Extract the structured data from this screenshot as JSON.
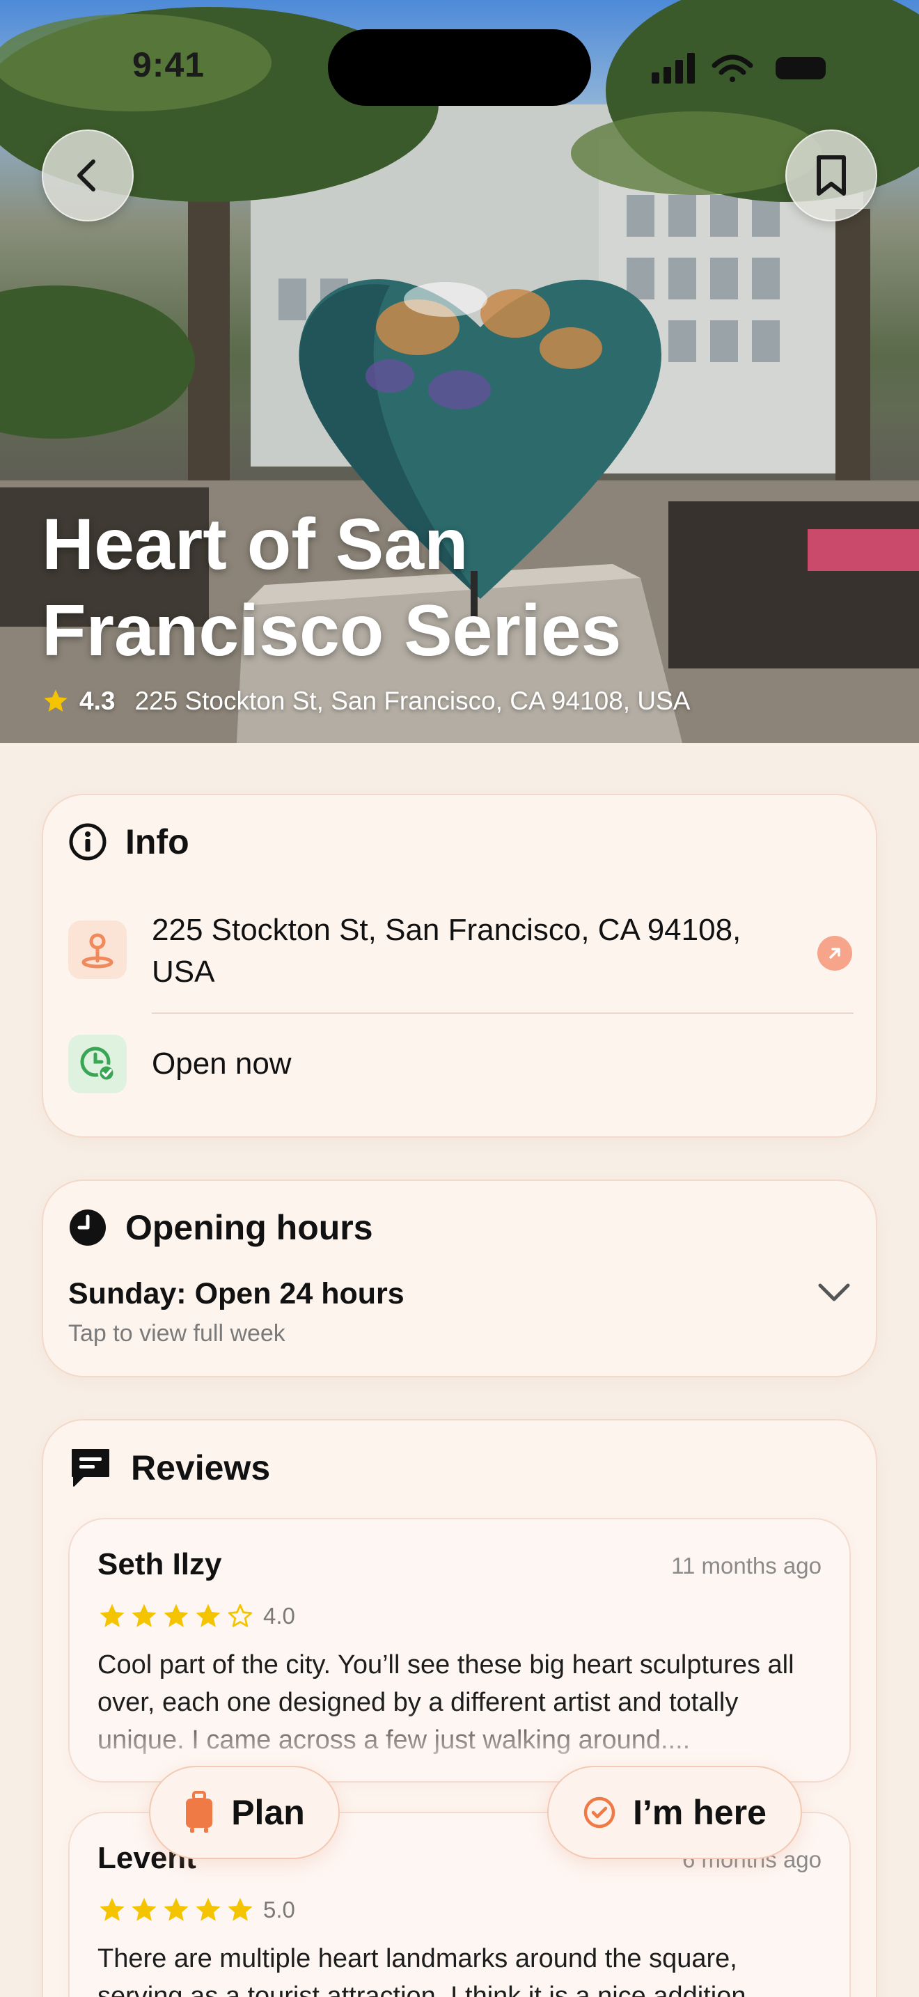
{
  "status_bar": {
    "time": "9:41"
  },
  "hero": {
    "title": "Heart of San Francisco Series",
    "rating": "4.3",
    "address": "225 Stockton St, San Francisco, CA 94108, USA"
  },
  "info": {
    "title": "Info",
    "address": "225 Stockton St, San Francisco, CA 94108, USA",
    "open_status": "Open now"
  },
  "opening_hours": {
    "title": "Opening hours",
    "today": "Sunday: Open 24 hours",
    "hint": "Tap to view full week"
  },
  "reviews": {
    "title": "Reviews",
    "items": [
      {
        "author": "Seth Ilzy",
        "when": "11 months ago",
        "stars": 4,
        "score": "4.0",
        "text": "Cool part of the city. You’ll see these big heart sculptures all over, each one designed by a different artist and totally unique. I came across a few just walking around...."
      },
      {
        "author": "Levent",
        "when": "6 months ago",
        "stars": 5,
        "score": "5.0",
        "text": "There are multiple heart landmarks around the square, serving as a tourist attraction. I think it is a nice addition"
      }
    ]
  },
  "actions": {
    "plan": "Plan",
    "here": "I’m here"
  },
  "colors": {
    "accent": "#f08a5d",
    "star": "#f5c400",
    "card_border": "#f3d9c9",
    "green": "#3aa655"
  }
}
